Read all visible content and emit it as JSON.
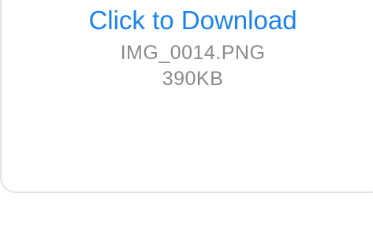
{
  "attachment": {
    "download_label": "Click to Download",
    "file_name": "IMG_0014.PNG",
    "file_size": "390KB"
  },
  "colors": {
    "link": "#1a82f0",
    "meta_text": "#8a8a8a",
    "card_border": "#e3e3e3"
  }
}
